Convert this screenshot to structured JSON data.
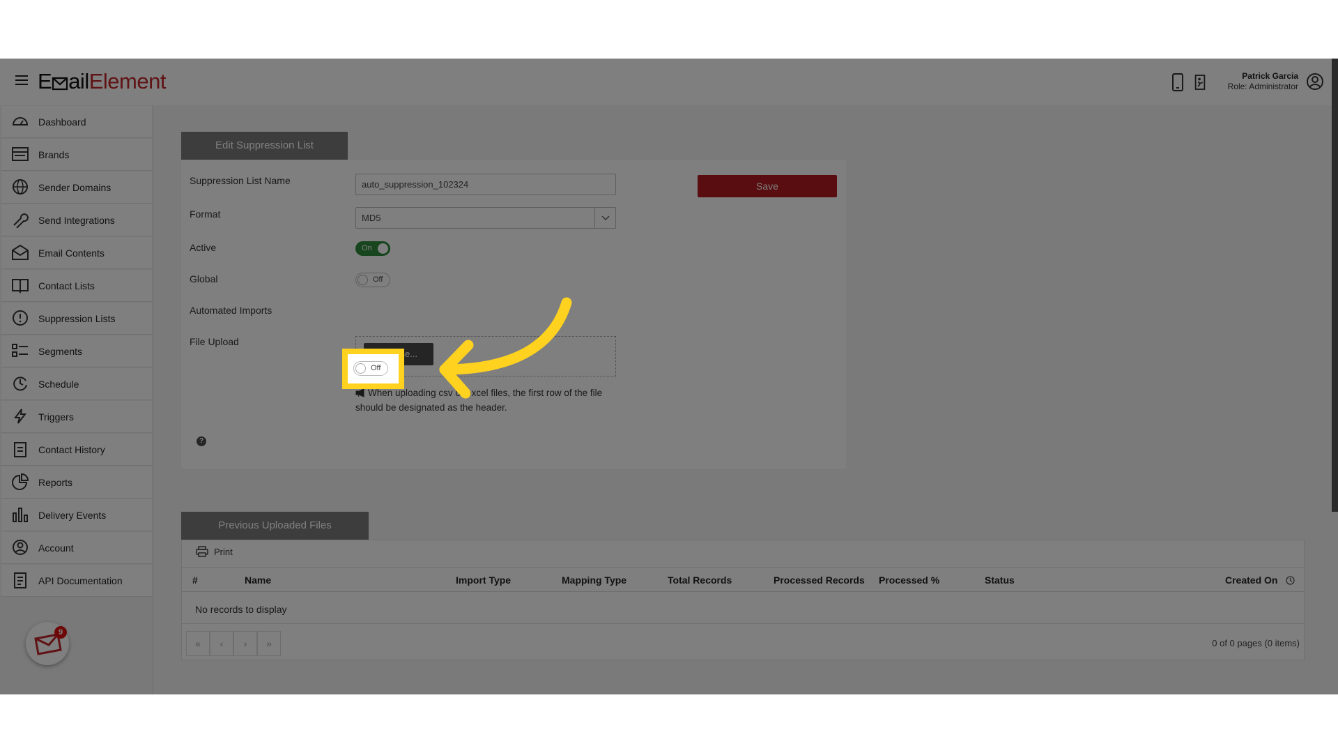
{
  "header": {
    "logo_part1": "E",
    "logo_part2": "ail",
    "logo_part3": "Element",
    "user_name": "Patrick Garcia",
    "user_role": "Role: Administrator"
  },
  "sidebar": {
    "items": [
      {
        "label": "Dashboard",
        "icon": "dashboard-icon"
      },
      {
        "label": "Brands",
        "icon": "brands-icon"
      },
      {
        "label": "Sender Domains",
        "icon": "globe-icon"
      },
      {
        "label": "Send Integrations",
        "icon": "wrench-icon"
      },
      {
        "label": "Email Contents",
        "icon": "envelope-icon"
      },
      {
        "label": "Contact Lists",
        "icon": "book-icon"
      },
      {
        "label": "Suppression Lists",
        "icon": "alert-icon"
      },
      {
        "label": "Segments",
        "icon": "segments-icon"
      },
      {
        "label": "Schedule",
        "icon": "clock-icon"
      },
      {
        "label": "Triggers",
        "icon": "bolt-icon"
      },
      {
        "label": "Contact History",
        "icon": "clipboard-icon"
      },
      {
        "label": "Reports",
        "icon": "pie-chart-icon"
      },
      {
        "label": "Delivery Events",
        "icon": "bar-chart-icon"
      },
      {
        "label": "Account",
        "icon": "user-circle-icon"
      },
      {
        "label": "API Documentation",
        "icon": "document-icon"
      }
    ],
    "notification_count": "9"
  },
  "edit_panel": {
    "tab_title": "Edit Suppression List",
    "name_label": "Suppression List Name",
    "name_value": "auto_suppression_102324",
    "format_label": "Format",
    "format_value": "MD5",
    "active_label": "Active",
    "active_state": "On",
    "global_label": "Global",
    "global_state": "Off",
    "automated_label": "Automated Imports",
    "automated_state": "Off",
    "upload_label": "File Upload",
    "browse_label": "Browse...",
    "hint_text": "When uploading csv or excel files, the first row of the file should be designated as the header.",
    "save_label": "Save",
    "help_symbol": "?"
  },
  "files_panel": {
    "tab_title": "Previous Uploaded Files",
    "print_label": "Print",
    "columns": [
      "#",
      "Name",
      "Import Type",
      "Mapping Type",
      "Total Records",
      "Processed Records",
      "Processed %",
      "Status",
      "Created On"
    ],
    "empty_text": "No records to display",
    "pager": {
      "first": "«",
      "prev": "‹",
      "next": "›",
      "last": "»",
      "info": "0 of 0 pages (0 items)"
    }
  },
  "colors": {
    "brand_red": "#c0262a",
    "save_button": "#b31b20",
    "toggle_on": "#2e8b3a",
    "highlight": "#ffd21f",
    "arrow": "#ffd21f"
  }
}
